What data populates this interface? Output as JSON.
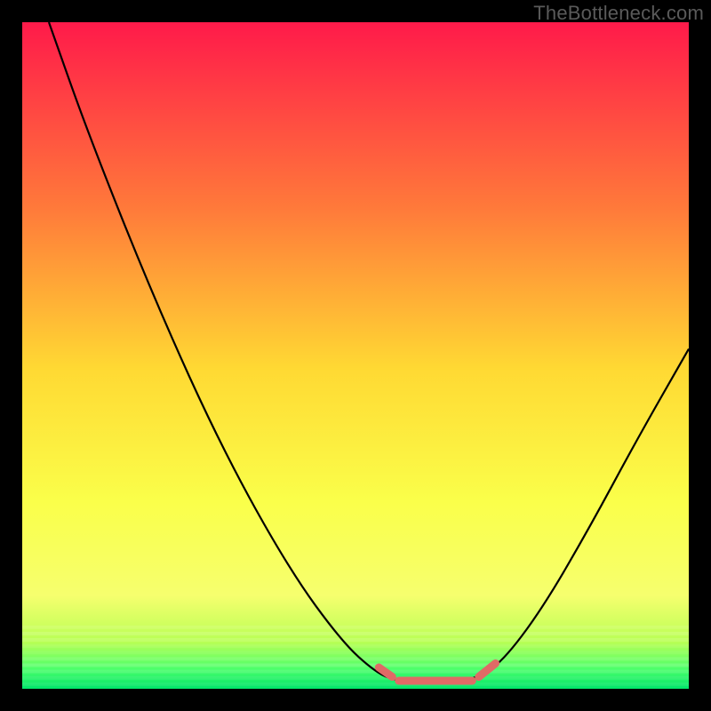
{
  "watermark": "TheBottleneck.com",
  "chart_data": {
    "type": "line",
    "title": "",
    "xlabel": "",
    "ylabel": "",
    "xlim": [
      0,
      100
    ],
    "ylim": [
      0,
      100
    ],
    "gradient_colors": {
      "top": "#ff1a4a",
      "mid1": "#ff7a3a",
      "mid2": "#ffd933",
      "mid3": "#faff4a",
      "bottom_yellow": "#f6ff6e",
      "green1": "#b8ff55",
      "green2": "#4cff6a",
      "green3": "#00e56a"
    },
    "series": [
      {
        "name": "bottleneck-curve",
        "stroke": "#000000",
        "points": [
          {
            "x": 4,
            "y": 100
          },
          {
            "x": 10,
            "y": 83
          },
          {
            "x": 20,
            "y": 58
          },
          {
            "x": 30,
            "y": 36
          },
          {
            "x": 40,
            "y": 18
          },
          {
            "x": 48,
            "y": 7
          },
          {
            "x": 53,
            "y": 2.5
          },
          {
            "x": 56,
            "y": 1.2
          },
          {
            "x": 60,
            "y": 1.0
          },
          {
            "x": 64,
            "y": 1.0
          },
          {
            "x": 68,
            "y": 1.5
          },
          {
            "x": 72,
            "y": 4
          },
          {
            "x": 78,
            "y": 12
          },
          {
            "x": 85,
            "y": 24
          },
          {
            "x": 92,
            "y": 37
          },
          {
            "x": 100,
            "y": 51
          }
        ]
      },
      {
        "name": "salmon-markers",
        "stroke": "#e06a66",
        "segments": [
          [
            {
              "x": 53.5,
              "y": 3.2
            },
            {
              "x": 55.5,
              "y": 1.8
            }
          ],
          [
            {
              "x": 56.5,
              "y": 1.2
            },
            {
              "x": 67.5,
              "y": 1.2
            }
          ],
          [
            {
              "x": 68.5,
              "y": 1.8
            },
            {
              "x": 71.0,
              "y": 3.8
            }
          ]
        ]
      }
    ]
  }
}
